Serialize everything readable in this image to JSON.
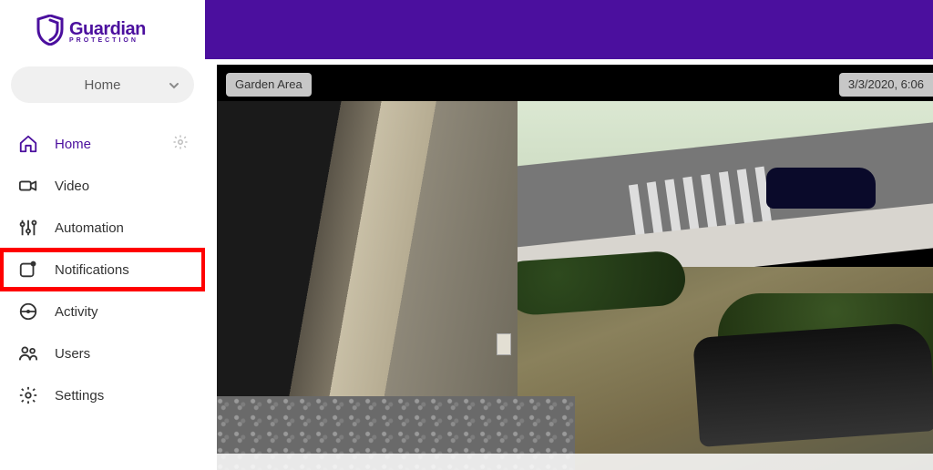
{
  "brand": {
    "name": "Guardian",
    "subtitle": "PROTECTION",
    "color": "#4b0f9e"
  },
  "location_selector": {
    "selected": "Home"
  },
  "sidebar": {
    "items": [
      {
        "key": "home",
        "label": "Home",
        "icon": "home-icon",
        "active": true,
        "has_settings": true
      },
      {
        "key": "video",
        "label": "Video",
        "icon": "video-camera-icon",
        "active": false
      },
      {
        "key": "automation",
        "label": "Automation",
        "icon": "sliders-icon",
        "active": false
      },
      {
        "key": "notifications",
        "label": "Notifications",
        "icon": "notification-icon",
        "active": false,
        "highlighted": true
      },
      {
        "key": "activity",
        "label": "Activity",
        "icon": "activity-icon",
        "active": false
      },
      {
        "key": "users",
        "label": "Users",
        "icon": "users-icon",
        "active": false
      },
      {
        "key": "settings",
        "label": "Settings",
        "icon": "gear-icon",
        "active": false
      }
    ]
  },
  "camera": {
    "name": "Garden Area",
    "timestamp": "3/3/2020, 6:06"
  }
}
